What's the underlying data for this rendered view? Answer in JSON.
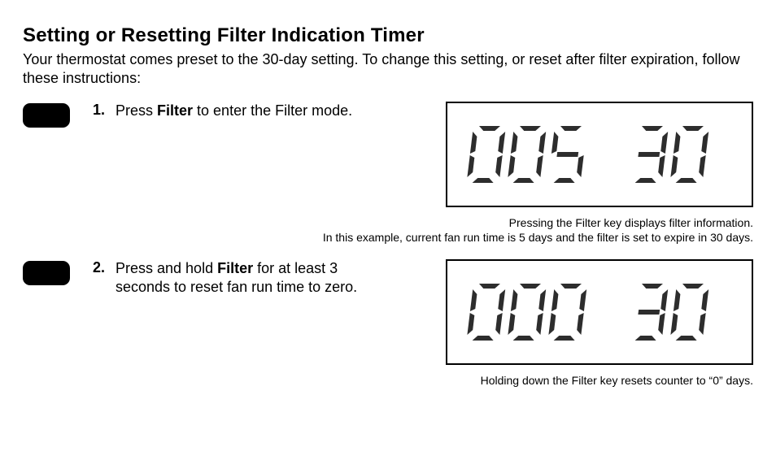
{
  "heading": "Setting or Resetting Filter Indication Timer",
  "intro": "Your thermostat comes preset to the 30-day setting. To change this setting, or reset after filter expiration, follow these instructions:",
  "steps": [
    {
      "num": "1.",
      "pre": "Press ",
      "bold": "Filter",
      "post": " to enter the Filter mode."
    },
    {
      "num": "2.",
      "pre": "Press and hold ",
      "bold": "Filter",
      "post": " for at least 3 seconds to reset fan run time to zero."
    }
  ],
  "displays": [
    {
      "left": "005",
      "right": "30"
    },
    {
      "left": "000",
      "right": "30"
    }
  ],
  "captions": [
    {
      "line1": "Pressing the Filter key displays filter information.",
      "line2": "In this example, current fan run time is 5 days and the filter is set to expire in 30 days."
    },
    {
      "line1": "Holding down the Filter key resets counter to “0” days."
    }
  ]
}
